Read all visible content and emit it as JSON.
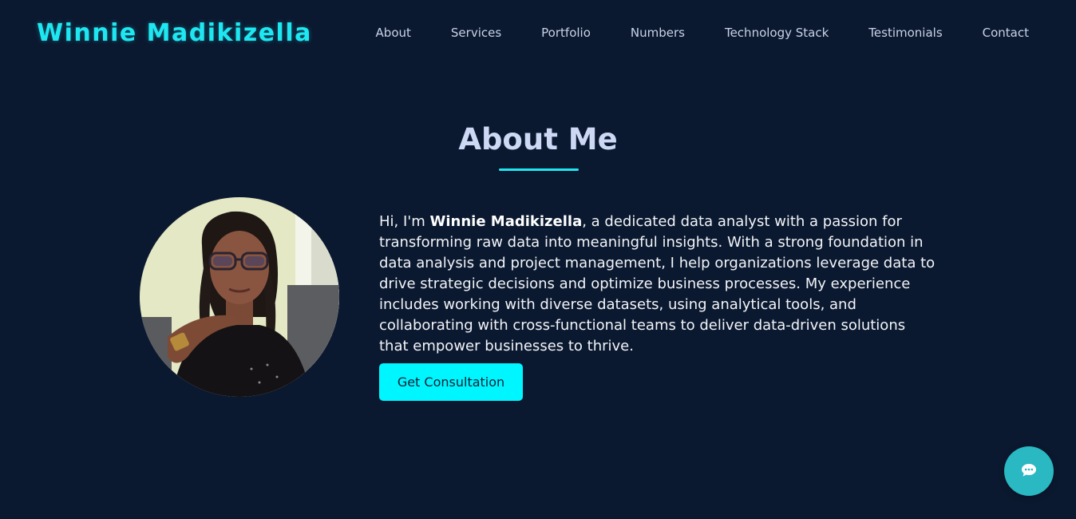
{
  "brand": {
    "name": "Winnie Madikizella"
  },
  "nav": {
    "items": [
      "About",
      "Services",
      "Portfolio",
      "Numbers",
      "Technology Stack",
      "Testimonials",
      "Contact"
    ]
  },
  "about": {
    "title": "About Me",
    "intro_prefix": "Hi, I'm ",
    "intro_name": "Winnie Madikizella",
    "intro_body": ", a dedicated data analyst with a passion for transforming raw data into meaningful insights. With a strong foundation in data analysis and project management, I help organizations leverage data to drive strategic decisions and optimize business processes. My experience includes working with diverse datasets, using analytical tools, and collaborating with cross-functional teams to deliver data-driven solutions that empower businesses to thrive.",
    "cta_label": "Get Consultation"
  },
  "colors": {
    "background": "#0b1930",
    "accent": "#1ee7f2",
    "button": "#00f6ff",
    "chat_button": "#2ab8c2"
  },
  "icons": {
    "chat": "chat-bubble-icon"
  }
}
